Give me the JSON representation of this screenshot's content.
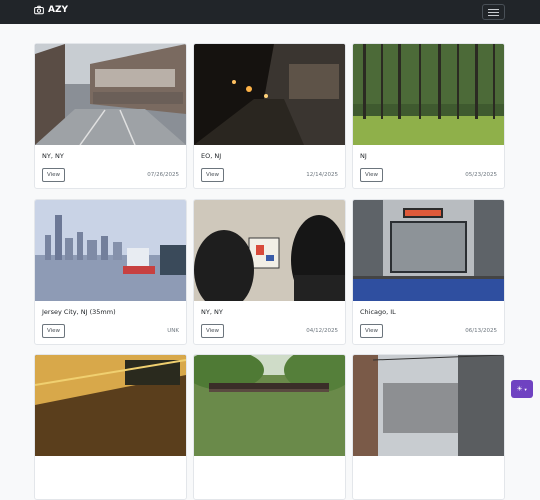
{
  "nav": {
    "brand": "AZY",
    "brand_icon": "camera-icon",
    "menu_icon": "hamburger-menu-icon"
  },
  "cards": [
    {
      "location": "NY, NY",
      "date": "07/26/2025",
      "button": "View"
    },
    {
      "location": "EO, NJ",
      "date": "12/14/2025",
      "button": "View"
    },
    {
      "location": "NJ",
      "date": "05/23/2025",
      "button": "View"
    },
    {
      "location": "Jersey City, NJ (35mm)",
      "date": "UNK",
      "button": "View"
    },
    {
      "location": "NY, NY",
      "date": "04/12/2025",
      "button": "View"
    },
    {
      "location": "Chicago, IL",
      "date": "06/13/2025",
      "button": "View"
    },
    {
      "location": "",
      "date": "",
      "button": ""
    },
    {
      "location": "",
      "date": "",
      "button": ""
    },
    {
      "location": "",
      "date": "",
      "button": ""
    }
  ],
  "theme_toggle": {
    "icon": "sun-icon",
    "caret_icon": "caret-down-icon",
    "color": "#6f42c1"
  },
  "colors": {
    "navbar": "#212529",
    "page": "#f8f9fa"
  }
}
